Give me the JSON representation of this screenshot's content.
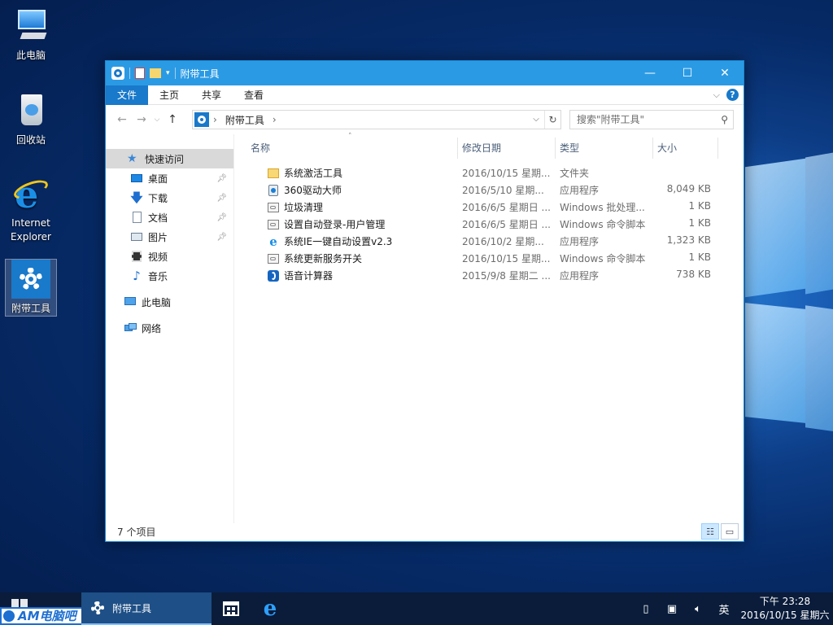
{
  "desktop": {
    "icons": [
      {
        "label": "此电脑"
      },
      {
        "label": "回收站"
      },
      {
        "label": "Internet Explorer"
      },
      {
        "label": "附带工具"
      }
    ]
  },
  "window": {
    "title": "附带工具",
    "controls": {
      "minimize": "—",
      "maximize": "☐",
      "close": "✕"
    }
  },
  "ribbon": {
    "tabs": [
      "文件",
      "主页",
      "共享",
      "查看"
    ],
    "help": "?"
  },
  "address": {
    "path": [
      "附带工具"
    ],
    "search_placeholder": "搜索\"附带工具\""
  },
  "navpane": {
    "items": [
      {
        "label": "快速访问",
        "icon": "star-icon"
      },
      {
        "label": "桌面",
        "icon": "desktop-icon"
      },
      {
        "label": "下载",
        "icon": "download-icon"
      },
      {
        "label": "文档",
        "icon": "document-icon"
      },
      {
        "label": "图片",
        "icon": "picture-icon"
      },
      {
        "label": "视频",
        "icon": "video-icon"
      },
      {
        "label": "音乐",
        "icon": "music-icon"
      },
      {
        "label": "此电脑",
        "icon": "computer-icon"
      },
      {
        "label": "网络",
        "icon": "network-icon"
      }
    ]
  },
  "columns": {
    "name": "名称",
    "date": "修改日期",
    "type": "类型",
    "size": "大小"
  },
  "files": [
    {
      "name": "系统激活工具",
      "date": "2016/10/15 星期...",
      "type": "文件夹",
      "size": "",
      "icon": "folder-icon"
    },
    {
      "name": "360驱动大师",
      "date": "2016/5/10 星期...",
      "type": "应用程序",
      "size": "8,049 KB",
      "icon": "app-icon"
    },
    {
      "name": "垃圾清理",
      "date": "2016/6/5 星期日 ...",
      "type": "Windows 批处理...",
      "size": "1 KB",
      "icon": "batch-icon"
    },
    {
      "name": "设置自动登录-用户管理",
      "date": "2016/6/5 星期日 ...",
      "type": "Windows 命令脚本",
      "size": "1 KB",
      "icon": "batch-icon"
    },
    {
      "name": "系统IE一键自动设置v2.3",
      "date": "2016/10/2 星期...",
      "type": "应用程序",
      "size": "1,323 KB",
      "icon": "ie-icon"
    },
    {
      "name": "系统更新服务开关",
      "date": "2016/10/15 星期...",
      "type": "Windows 命令脚本",
      "size": "1 KB",
      "icon": "batch-icon"
    },
    {
      "name": "语音计算器",
      "date": "2015/9/8 星期二 ...",
      "type": "应用程序",
      "size": "738 KB",
      "icon": "calc-icon"
    }
  ],
  "status": {
    "count": "7 个项目"
  },
  "taskbar": {
    "logo": "AM电脑吧",
    "task_label": "附带工具",
    "ime": "英",
    "time": "下午 23:28",
    "date": "2016/10/15 星期六"
  }
}
